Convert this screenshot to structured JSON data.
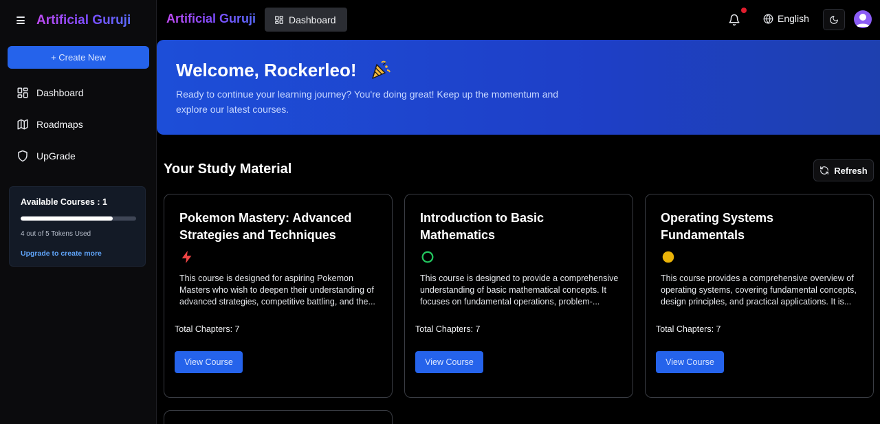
{
  "app": {
    "brand": "Artificial Guruji"
  },
  "sidebar": {
    "create_label": "+ Create New",
    "items": [
      {
        "label": "Dashboard",
        "icon": "dashboard-grid-icon"
      },
      {
        "label": "Roadmaps",
        "icon": "map-icon"
      },
      {
        "label": "UpGrade",
        "icon": "shield-icon"
      }
    ],
    "courses_card": {
      "title": "Available Courses : 1",
      "tokens_used": 4,
      "tokens_total": 5,
      "progress_fraction": 0.8,
      "tokens_text": "4 out of 5 Tokens Used",
      "upgrade_link": "Upgrade to create more"
    }
  },
  "topbar": {
    "brand": "Artificial Guruji",
    "dashboard_label": "Dashboard",
    "language": "English",
    "has_notification": true
  },
  "banner": {
    "title": "Welcome, Rockerleo!",
    "emoji": "party-popper-icon",
    "subtitle": "Ready to continue your learning journey? You're doing great! Keep up the momentum and explore our latest courses."
  },
  "study": {
    "title": "Your Study Material",
    "refresh_label": "Refresh",
    "courses": [
      {
        "title": "Pokemon Mastery: Advanced Strategies and Techniques",
        "icon": "lightning-icon",
        "icon_color": "#ef4444",
        "description": "This course is designed for aspiring Pokemon Masters who wish to deepen their understanding of advanced strategies, competitive battling, and the...",
        "chapters": "Total Chapters: 7",
        "button": "View Course"
      },
      {
        "title": "Introduction to Basic Mathematics",
        "icon": "circle-outline-icon",
        "icon_color": "#22c55e",
        "description": "This course is designed to provide a comprehensive understanding of basic mathematical concepts. It focuses on fundamental operations, problem-...",
        "chapters": "Total Chapters: 7",
        "button": "View Course"
      },
      {
        "title": "Operating Systems Fundamentals",
        "icon": "filled-circle-icon",
        "icon_color": "#eab308",
        "description": "This course provides a comprehensive overview of operating systems, covering fundamental concepts, design principles, and practical applications. It is...",
        "chapters": "Total Chapters: 7",
        "button": "View Course"
      }
    ]
  },
  "colors": {
    "accent": "#2563eb",
    "brand_gradient_start": "#c04bf2",
    "brand_gradient_end": "#5b6cff",
    "notification_dot": "#e11d2e"
  }
}
